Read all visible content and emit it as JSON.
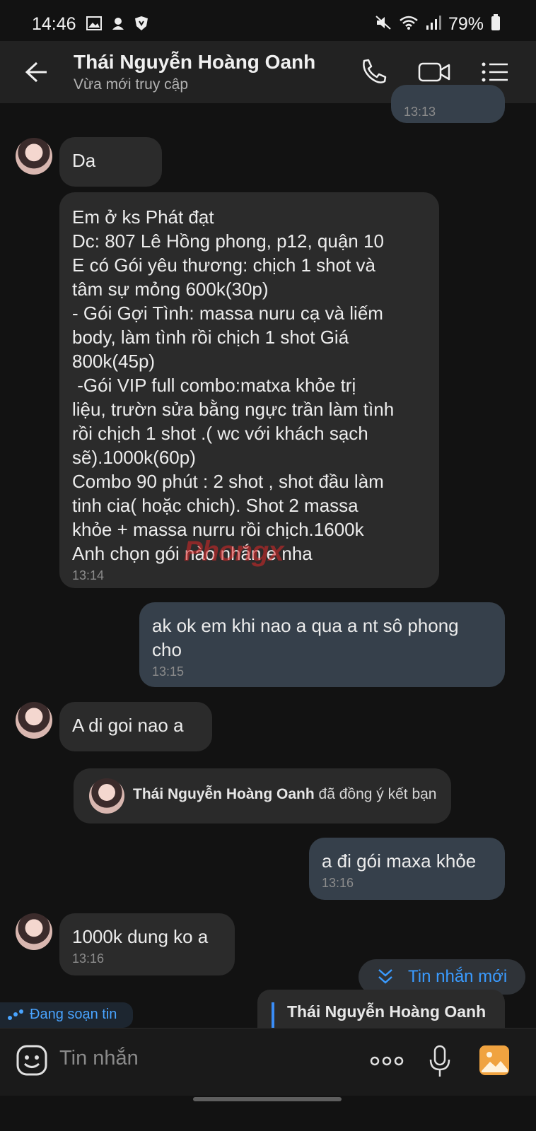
{
  "status_bar": {
    "time": "14:46",
    "battery": "79%"
  },
  "header": {
    "contact_name": "Thái Nguyễn Hoàng Oanh",
    "contact_status": "Vừa mới truy cập"
  },
  "messages": [
    {
      "dir": "out",
      "time": "13:13"
    },
    {
      "dir": "in",
      "text": "Da"
    },
    {
      "dir": "in",
      "lines": [
        "Em ở ks Phát đạt",
        "Dc: 807 Lê Hồng phong, p12, quận 10",
        "E có Gói yêu thương: chịch 1 shot và",
        "tâm sự mỏng 600k(30p)",
        "- Gói Gợi Tình: massa nuru cạ và liếm",
        "body, làm tình rồi chịch 1 shot Giá",
        "800k(45p)",
        " -Gói VIP full combo:matxa khỏe trị",
        "liệu, trườn sửa bằng ngực trần làm tình",
        "rồi chịch 1 shot .( wc với khách sạch",
        "sẽ).1000k(60p)",
        "Combo 90 phút : 2 shot , shot đầu làm",
        "tinh cia( hoặc chich). Shot 2 massa",
        "khỏe + massa nurru rồi chịch.1600k",
        "Anh chọn gói nào nhắn e nha"
      ],
      "time": "13:14"
    },
    {
      "dir": "out",
      "lines": [
        "ak ok em khi nao a qua a nt sô phong",
        "cho"
      ],
      "time": "13:15"
    },
    {
      "dir": "in",
      "text": "A di goi nao a"
    },
    {
      "dir": "out",
      "text": "a đi gói maxa khỏe",
      "time": "13:16"
    },
    {
      "dir": "in",
      "text": "1000k dung ko a",
      "time": "13:16"
    }
  ],
  "system_notice": {
    "name": "Thái Nguyễn Hoàng Oanh",
    "text": " đã đồng ý kết bạn"
  },
  "watermark": "Phongx",
  "new_messages_label": "Tin nhắn mới",
  "typing_label": "Đang soạn tin",
  "reply_preview_name": "Thái Nguyễn Hoàng Oanh",
  "input": {
    "placeholder": "Tin nhắn"
  },
  "colors": {
    "accent": "#3a9bff",
    "incoming": "#2b2b2b",
    "outgoing": "#36404b",
    "background": "#121212"
  }
}
